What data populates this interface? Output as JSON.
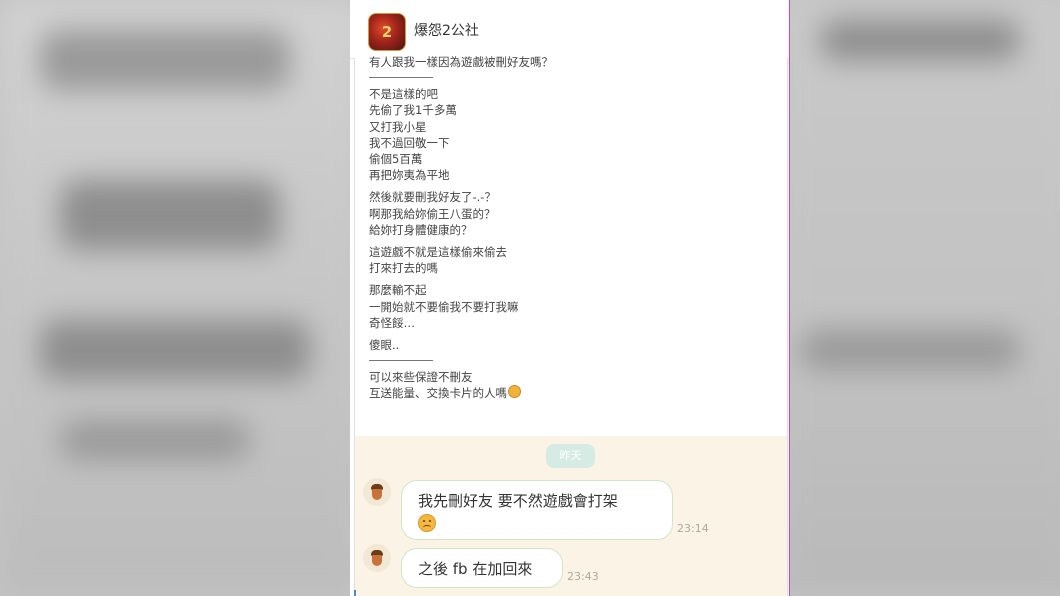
{
  "app": {
    "title": "爆怨2公社",
    "icon": "game-app-icon"
  },
  "post": {
    "first_line": "有人跟我一樣因為遊戲被刪好友嗎？",
    "block1": [
      "不是這樣的吧",
      "先偷了我1千多萬",
      "又打我小星",
      "我不過回敬一下",
      "偷個5百萬",
      "再把妳夷為平地"
    ],
    "block2": [
      "然後就要刪我好友了-.-？",
      "啊那我給妳偷王八蛋的？",
      "給妳打身體健康的？"
    ],
    "block3": [
      "這遊戲不就是這樣偷來偷去",
      "打來打去的嗎"
    ],
    "block4": [
      "那麼輸不起",
      "一開始就不要偷我不要打我嘛",
      "奇怪餒…"
    ],
    "block5": "傻眼..",
    "block6": [
      "可以來些保證不刪友",
      "互送能量、交換卡片的人嗎"
    ]
  },
  "chat": {
    "date_label": "昨天",
    "messages": [
      {
        "line1": "我先刪好友 要不然遊戲會打架",
        "emoji": "disappointed-face-emoji",
        "time": "23:14"
      },
      {
        "line1": "之後 fb 在加回來",
        "time": "23:43"
      }
    ]
  },
  "colors": {
    "chat_bg": "#faf3e6",
    "bubble_border": "#cfe7c8",
    "date_pill": "#d6ebe4"
  }
}
